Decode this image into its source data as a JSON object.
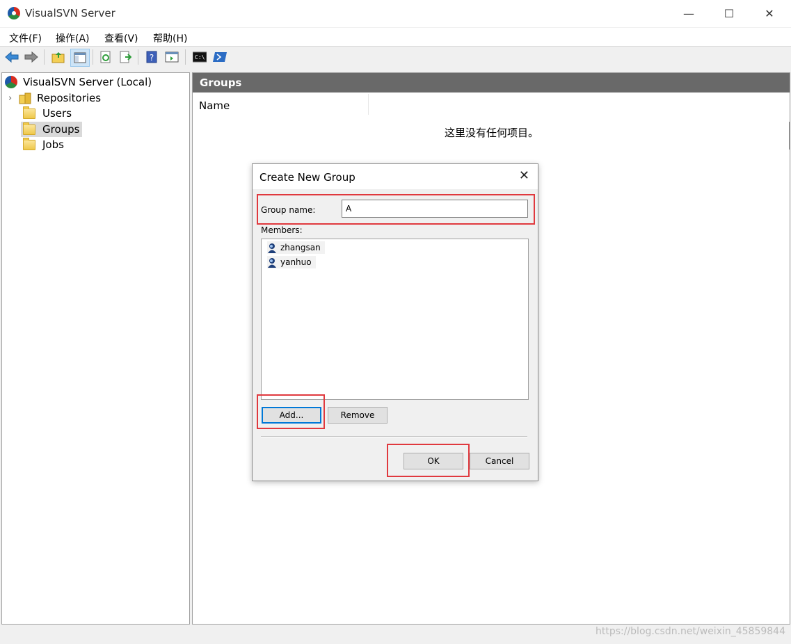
{
  "window": {
    "title": "VisualSVN Server",
    "minimize": "—",
    "maximize": "☐",
    "close": "✕"
  },
  "menu": [
    "文件(F)",
    "操作(A)",
    "查看(V)",
    "帮助(H)"
  ],
  "toolbar": {
    "icons": [
      "back-arrow-icon",
      "forward-arrow-icon",
      "up-folder-icon",
      "show-hide-tree-icon",
      "refresh-icon",
      "export-list-icon",
      "help-icon",
      "properties-icon",
      "command-prompt-icon",
      "powershell-icon"
    ],
    "cmd_text": "C:\\"
  },
  "tree": {
    "root": "VisualSVN Server (Local)",
    "items": [
      {
        "label": "Repositories",
        "expander": "›"
      },
      {
        "label": "Users"
      },
      {
        "label": "Groups",
        "selected": true
      },
      {
        "label": "Jobs"
      }
    ]
  },
  "rightpane": {
    "header": "Groups",
    "column": "Name",
    "empty_message": "这里没有任何项目。"
  },
  "dialog": {
    "title": "Create New Group",
    "close": "✕",
    "group_name_label": "Group name:",
    "group_name_value": "A",
    "members_label": "Members:",
    "members": [
      "zhangsan",
      "yanhuo"
    ],
    "add_button": "Add...",
    "remove_button": "Remove",
    "ok_button": "OK",
    "cancel_button": "Cancel"
  },
  "watermark": "https://blog.csdn.net/weixin_45859844",
  "colors": {
    "highlight": "#e0393e",
    "header_bg": "#696969",
    "focus_border": "#0078d7"
  }
}
